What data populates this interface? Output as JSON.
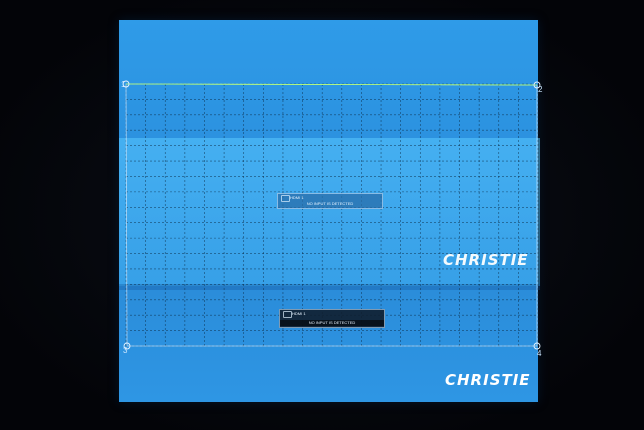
{
  "scene": {
    "colors": {
      "background": "#05070c",
      "screen_blue": "#2d93e2",
      "overlap_blue": "#5ac8ff",
      "grid_line": "#0b2a44",
      "corner_outline": "#b6ff6a"
    }
  },
  "warp_grid": {
    "columns": 21,
    "rows": 17,
    "corner_points": [
      {
        "label": "1"
      },
      {
        "label": "2"
      },
      {
        "label": "3"
      },
      {
        "label": "4"
      }
    ]
  },
  "osd_upper": {
    "icon": "hdmi-input-icon",
    "source": "HDMI 1",
    "message": "NO INPUT IS DETECTED"
  },
  "osd_lower": {
    "icon": "hdmi-input-icon",
    "source": "HDMI 1",
    "message": "NO INPUT IS DETECTED"
  },
  "brand": {
    "upper_logo": "CHRISTIE",
    "lower_logo": "CHRISTIE"
  }
}
